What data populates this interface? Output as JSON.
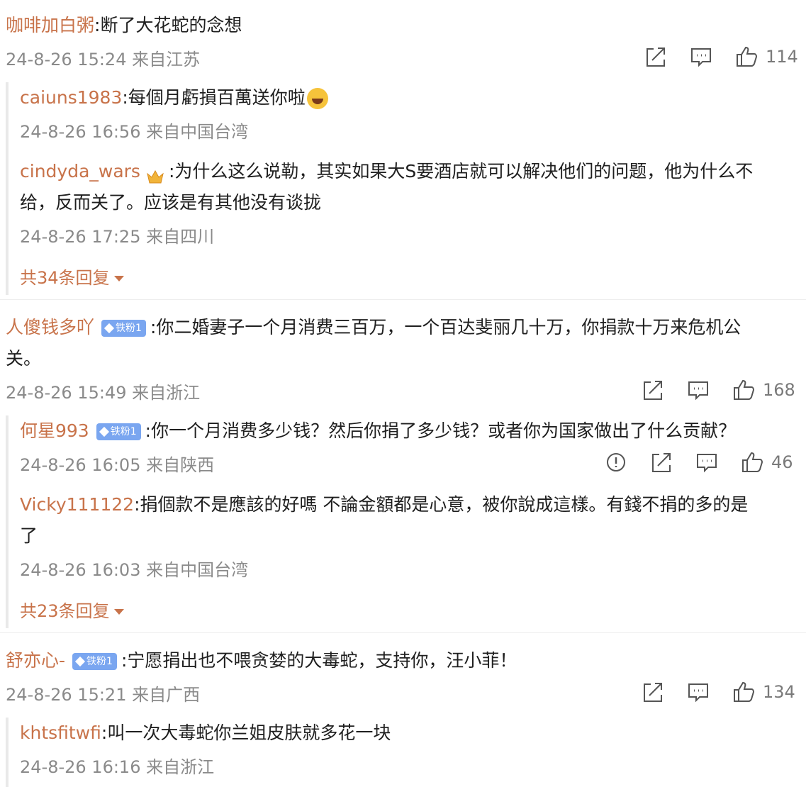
{
  "comments": [
    {
      "user": "咖啡加白粥",
      "text": ":断了大花蛇的念想",
      "meta": "24-8-26 15:24 来自江苏",
      "likes": "114",
      "replies": [
        {
          "user": "caiuns1983",
          "text": ":每個月虧損百萬送你啦",
          "meta": "24-8-26 16:56 来自中国台湾"
        },
        {
          "user": "cindyda_wars",
          "text": ":为什么这么说勒，其实如果大S要酒店就可以解决他们的问题，他为什么不",
          "text2": "给，反而关了。应该是有其他没有谈拢",
          "meta": "24-8-26 17:25 来自四川"
        }
      ],
      "more": "共34条回复"
    },
    {
      "user": "人傻钱多吖",
      "badge": "铁粉1",
      "text": ":你二婚妻子一个月消费三百万，一个百达斐丽几十万，你捐款十万来危机公",
      "text2": "关。",
      "meta": "24-8-26 15:49 来自浙江",
      "likes": "168",
      "replies": [
        {
          "user": "何星993",
          "badge": "铁粉1",
          "text": ":你一个月消费多少钱？然后你捐了多少钱？或者你为国家做出了什么贡献？",
          "meta": "24-8-26 16:05 来自陕西",
          "likes": "46"
        },
        {
          "user": "Vicky111122",
          "text": ":捐個款不是應該的好嗎 不論金額都是心意，被你說成這樣。有錢不捐的多的是",
          "text2": "了",
          "meta": "24-8-26 16:03 来自中国台湾"
        }
      ],
      "more": "共23条回复"
    },
    {
      "user": "舒亦心-",
      "badge": "铁粉1",
      "text": ":宁愿捐出也不喂贪婪的大毒蛇，支持你，汪小菲！",
      "meta": "24-8-26 15:21 来自广西",
      "likes": "134",
      "replies": [
        {
          "user": "khtsfitwfi",
          "text": ":叫一次大毒蛇你兰姐皮肤就多花一块",
          "meta": "24-8-26 16:16 来自浙江"
        }
      ]
    }
  ]
}
